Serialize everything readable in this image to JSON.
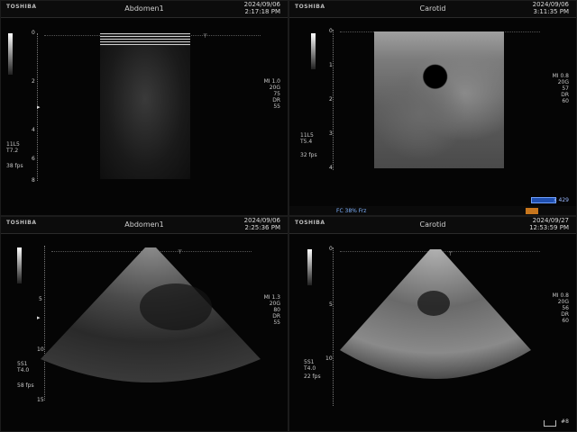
{
  "panels": [
    {
      "brand": "TOSHIBA",
      "preset": "Abdomen1",
      "date": "2024/09/06",
      "time": "2:17:18 PM",
      "depth_ticks": [
        "0",
        "2",
        "4",
        "6",
        "8"
      ],
      "params_right": [
        "MI 1.0",
        "20G",
        "75",
        "DR",
        "55"
      ],
      "params_left": [
        "11L5",
        "T7.2"
      ],
      "fps": "38 fps",
      "focus_marker": "▸"
    },
    {
      "brand": "TOSHIBA",
      "preset": "Carotid",
      "date": "2024/09/06",
      "time": "3:11:35 PM",
      "depth_ticks": [
        "0",
        "1",
        "2",
        "3",
        "4"
      ],
      "params_right": [
        "MI 0.8",
        "20G",
        "57",
        "DR",
        "60"
      ],
      "params_left": [
        "11L5",
        "T5.4"
      ],
      "fps": "32 fps",
      "status_text": "FC 38% Frz",
      "right_label": "x 429"
    },
    {
      "brand": "TOSHIBA",
      "preset": "Abdomen1",
      "date": "2024/09/06",
      "time": "2:25:36 PM",
      "depth_ticks": [
        "5",
        "10",
        "15"
      ],
      "params_right": [
        "MI 1.3",
        "20G",
        "80",
        "DR",
        "55"
      ],
      "params_left": [
        "5S1",
        "T4.0"
      ],
      "fps": "58 fps",
      "focus_marker": "▸"
    },
    {
      "brand": "TOSHIBA",
      "preset": "Carotid",
      "date": "2024/09/27",
      "time": "12:53:59 PM",
      "depth_ticks": [
        "0",
        "5",
        "10"
      ],
      "params_right": [
        "MI 0.8",
        "20G",
        "56",
        "DR",
        "60"
      ],
      "params_left": [
        "5S1",
        "T4.0"
      ],
      "fps": "22 fps",
      "scale_label": "#8"
    }
  ]
}
